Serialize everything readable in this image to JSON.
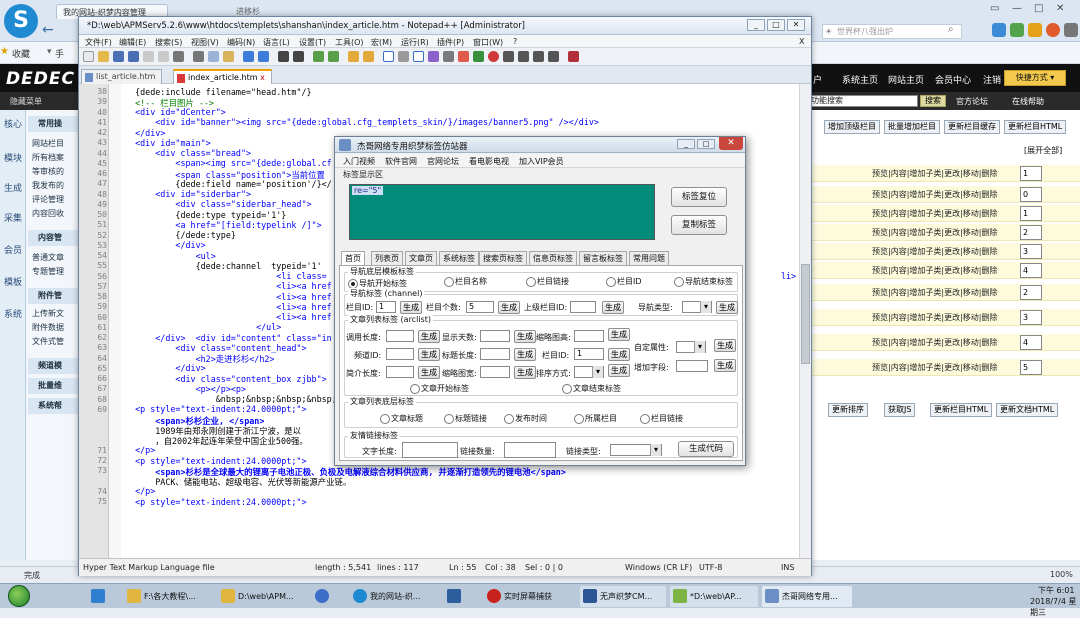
{
  "browser": {
    "tab1": "我的网站-织梦内容管理",
    "tab2": "进移杉",
    "search_placeholder": "世界杯八强出炉",
    "favorites_label": "收藏",
    "fav_item2": "手",
    "status_done": "完成",
    "zoom": "100%"
  },
  "dede": {
    "logo": "DEDEC",
    "nav": [
      "户",
      "系统主页",
      "网站主页",
      "会员中心",
      "注销"
    ],
    "quick_label": "快捷方式",
    "hide_menu": "隐藏菜单",
    "search_value": "功能搜索",
    "search_button": "搜索",
    "forum_link": "官方论坛",
    "help_link": "在线帮助",
    "left_tabs": [
      "核心",
      "模块",
      "生成",
      "采集",
      "会员",
      "模板",
      "系统"
    ],
    "menu_groups": [
      "常用操",
      "内容管",
      "附件管",
      "频道模",
      "批量维",
      "系统帮"
    ],
    "menu_items": [
      "网站栏目",
      "所有档案",
      "等审核的",
      "我发布的",
      "评论管理",
      "内容回收",
      "普通文章",
      "专题管理",
      "上传新文",
      "附件数据",
      "文件式管",
      "",
      "",
      ""
    ],
    "rp_top_buttons": [
      "增加顶级栏目",
      "批量增加栏目",
      "更新栏目缓存",
      "更新栏目HTML"
    ],
    "expand_all": "[展开全部]",
    "rp_rows": [
      {
        "ops": "预览|内容|增加子类|更改|移动|删除",
        "order": "1"
      },
      {
        "ops": "预览|内容|增加子类|更改|移动|删除",
        "order": "0"
      },
      {
        "ops": "预览|内容|增加子类|更改|移动|删除",
        "order": "1"
      },
      {
        "ops": "预览|内容|增加子类|更改|移动|删除",
        "order": "2"
      },
      {
        "ops": "预览|内容|增加子类|更改|移动|删除",
        "order": "3"
      },
      {
        "ops": "预览|内容|增加子类|更改|移动|删除",
        "order": "4"
      },
      {
        "ops": "预览|内容|增加子类|更改|移动|删除",
        "order": "2"
      },
      {
        "ops": "预览|内容|增加子类|更改|移动|删除",
        "order": "3"
      },
      {
        "ops": "预览|内容|增加子类|更改|移动|删除",
        "order": "4"
      },
      {
        "ops": "预览|内容|增加子类|更改|移动|删除",
        "order": "5"
      }
    ],
    "rp_bottom_buttons": [
      "更新排序",
      "获取JS",
      "更新栏目HTML",
      "更新文档HTML"
    ]
  },
  "taskbar": {
    "items": [
      "F:\\各大教程\\...",
      "D:\\web\\APM...",
      "",
      "我的网站-织...",
      "",
      "实时屏幕捕获",
      "无声织梦CM...",
      "*D:\\web\\AP...",
      "杰哥网络专用..."
    ],
    "time": "下午 6:01",
    "date": "2018/7/4 星期三"
  },
  "npp": {
    "title": "*D:\\web\\APMServ5.2.6\\www\\htdocs\\templets\\shanshan\\index_article.htm - Notepad++ [Administrator]",
    "menu": [
      "文件(F)",
      "编辑(E)",
      "搜索(S)",
      "视图(V)",
      "编码(N)",
      "语言(L)",
      "设置(T)",
      "工具(O)",
      "宏(M)",
      "运行(R)",
      "插件(P)",
      "窗口(W)",
      "?"
    ],
    "tabs": [
      "list_article.htm",
      "index_article.htm"
    ],
    "status": {
      "type": "Hyper Text Markup Language file",
      "length": "length : 5,541",
      "lines": "lines : 117",
      "ln": "Ln : 55",
      "col": "Col : 38",
      "sel": "Sel : 0 | 0",
      "eol": "Windows (CR LF)",
      "enc": "UTF-8",
      "mode": "INS"
    },
    "lines": [
      {
        "n": "38",
        "t": "  {dede:include filename=\"head.htm\"/}"
      },
      {
        "n": "39",
        "t": "  <!-- 栏目图片 -->"
      },
      {
        "n": "40",
        "t": "  <div id=\"dCenter\">"
      },
      {
        "n": "41",
        "t": "      <div id=\"banner\"><img src=\"{dede:global.cfg_templets_skin/}/images/banner5.png\" /></div>"
      },
      {
        "n": "42",
        "t": "  </div>"
      },
      {
        "n": "43",
        "t": "  <div id=\"main\">"
      },
      {
        "n": "44",
        "t": "      <div class=\"bread\">"
      },
      {
        "n": "45",
        "t": "          <span><img src=\"{dede:global.cf"
      },
      {
        "n": "46",
        "t": "          <span class=\"position\">当前位置"
      },
      {
        "n": "47",
        "t": "          {dede:field name='position'/}</"
      },
      {
        "n": "48",
        "t": "      <div id=\"siderbar\">"
      },
      {
        "n": "49",
        "t": "          <div class=\"siderbar_head\">"
      },
      {
        "n": "50",
        "t": "          {dede:type typeid='1'}"
      },
      {
        "n": "51",
        "t": "          <a href=\"[field:typelink /]\">"
      },
      {
        "n": "52",
        "t": "          {/dede:type}"
      },
      {
        "n": "53",
        "t": "          </div>"
      },
      {
        "n": "54",
        "t": "              <ul>"
      },
      {
        "n": "55",
        "t": "              {dede:channel  typeid='1' "
      },
      {
        "n": "56",
        "t": "                              <li class="
      },
      {
        "n": "57",
        "t": "                              <li><a href"
      },
      {
        "n": "58",
        "t": "                              <li><a href"
      },
      {
        "n": "59",
        "t": "                              <li><a href"
      },
      {
        "n": "60",
        "t": "                              <li><a href"
      },
      {
        "n": "61",
        "t": "                          </ul>"
      },
      {
        "n": "62",
        "t": "      </div>  <div id=\"content\" class=\"in"
      },
      {
        "n": "63",
        "t": "          <div class=\"content_head\">"
      },
      {
        "n": "64",
        "t": "              <h2>走进杉杉</h2>"
      },
      {
        "n": "65",
        "t": "          </div>"
      },
      {
        "n": "66",
        "t": "          <div class=\"content_box zjbb\">"
      },
      {
        "n": "67",
        "t": "              <p></p><p>"
      },
      {
        "n": "68",
        "t": "                  &nbsp;&nbsp;&nbsp;&nbsp;"
      },
      {
        "n": "69",
        "t": "  <p style=\"text-indent:24.0000pt;\">"
      },
      {
        "n": "",
        "t": "      <span>杉杉企业, </span>"
      },
      {
        "n": "",
        "t": "      1989年由郑永刚创建于浙江宁波，是以                                                     业集团"
      },
      {
        "n": "",
        "t": "      ，自2002年起连年荣登中国企业500强。"
      },
      {
        "n": "71",
        "t": "  </p>"
      },
      {
        "n": "72",
        "t": "  <p style=\"text-indent:24.0000pt;\">"
      },
      {
        "n": "73",
        "t": "      <span>杉杉是全球最大的锂离子电池正极、负极及电解液综合材料供应商, 并逐渐打造领先的锂电池</span>"
      },
      {
        "n": "",
        "t": "      PACK、储能电站、超级电容、光伏等新能源产业链。"
      },
      {
        "n": "74",
        "t": "  </p>"
      },
      {
        "n": "75",
        "t": "  <p style=\"text-indent:24.0000pt;\">"
      }
    ],
    "line56_tail": "li>"
  },
  "dialog": {
    "title": "杰哥网络专用织梦标签仿站器",
    "menu": [
      "入门视频",
      "软件官网",
      "官网论坛",
      "看电影电视",
      "加入VIP会员"
    ],
    "display_label": "标签显示区",
    "display_text": "re=\"5\"",
    "reset_button": "标签复位",
    "copy_button": "复制标签",
    "tabs": [
      "首页",
      "列表页",
      "文章页",
      "系统标签",
      "搜索页标签",
      "信息页标签",
      "留言板标签",
      "常用问题"
    ],
    "nav_tpl": {
      "title": "导航底层模板标签",
      "radios": [
        "导航开始标签",
        "栏目名称",
        "栏目链接",
        "栏目ID",
        "导航结束标签"
      ]
    },
    "nav_tag": {
      "title": "导航标签 (channel)",
      "typeid_label": "栏目ID:",
      "typeid_value": "1",
      "count_label": "栏目个数:",
      "count_value": "5",
      "parent_label": "上级栏目ID:",
      "type_label": "导航类型:",
      "gen": "生成"
    },
    "arc": {
      "title": "文章列表标签 (arclist)",
      "fields": [
        "调用长度:",
        "显示天数:",
        "缩略图高:",
        "频道ID:",
        "标题长度:",
        "栏目ID:",
        "简介长度:",
        "缩略图宽:",
        "排序方式:"
      ],
      "typeid_value": "1",
      "custom_attr": "自定属性:",
      "add_field": "增加字段:",
      "start_radio": "文章开始标签",
      "end_radio": "文章结束标签",
      "gen": "生成"
    },
    "arc_bottom": {
      "title": "文章列表底层标签",
      "radios": [
        "文章标题",
        "标题链接",
        "发布时间",
        "所属栏目",
        "栏目链接"
      ]
    },
    "link": {
      "title": "友情链接标签",
      "text_len": "文字长度:",
      "count": "链接数量:",
      "type": "链接类型:",
      "gen_code": "生成代码"
    }
  }
}
